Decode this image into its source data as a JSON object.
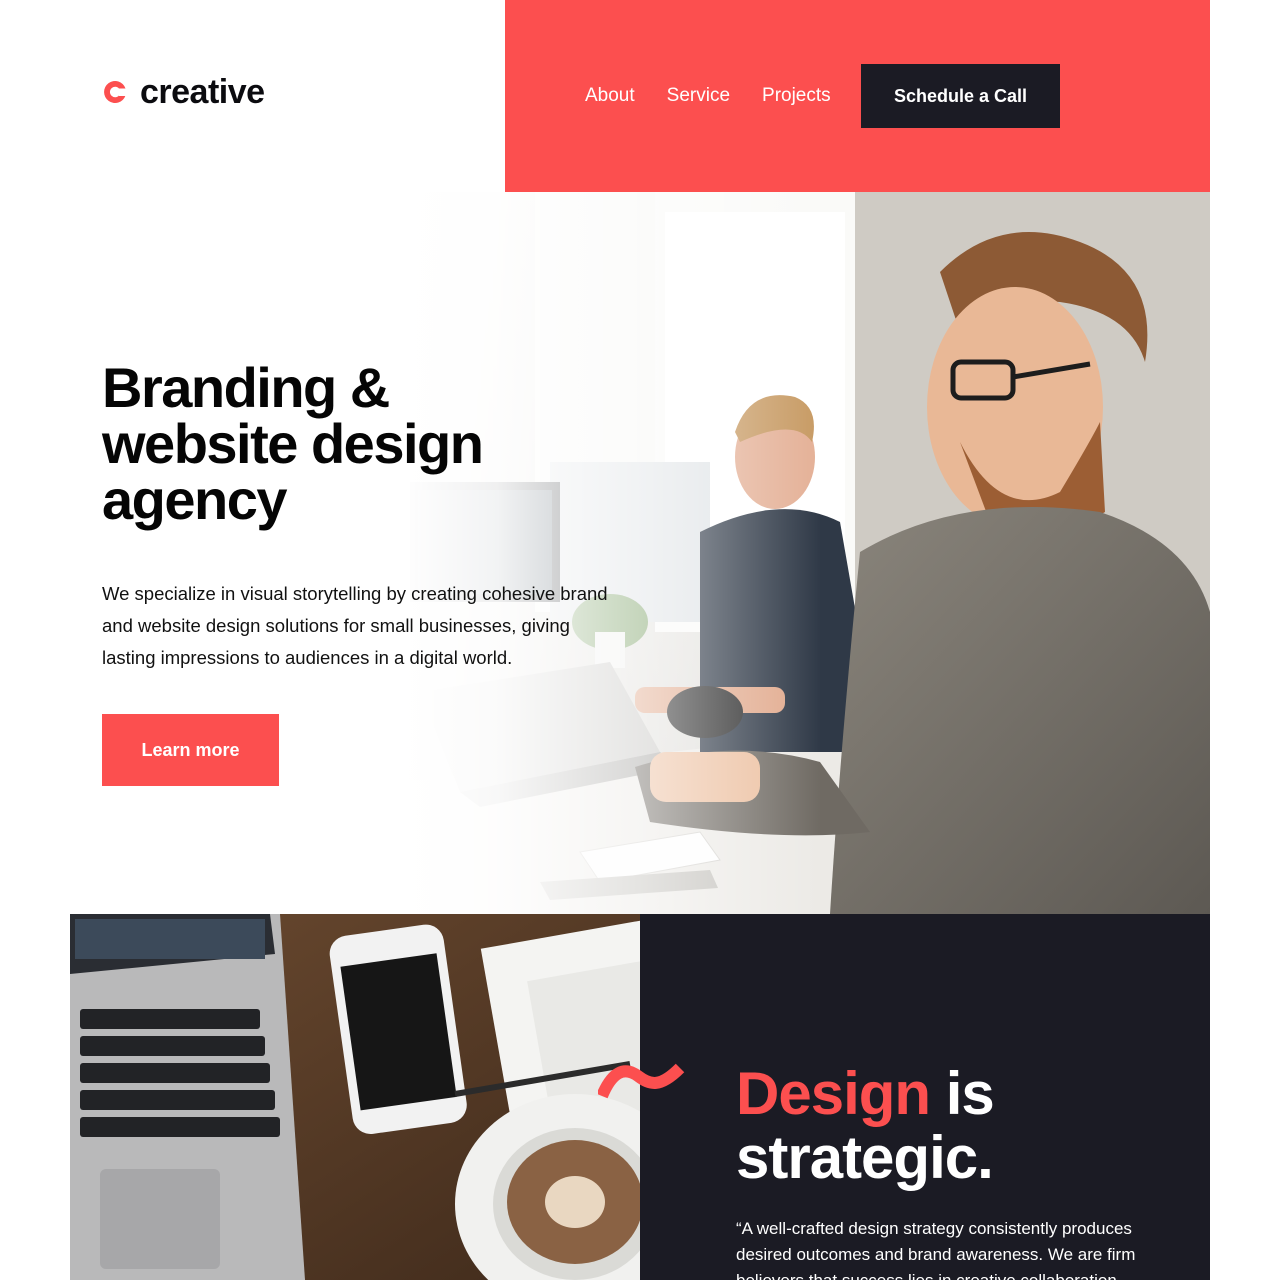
{
  "brand": {
    "name": "creative",
    "accent_color": "#fc4f4f",
    "dark_color": "#1b1b24"
  },
  "nav": {
    "items": [
      {
        "label": "About"
      },
      {
        "label": "Service"
      },
      {
        "label": "Projects"
      }
    ],
    "cta_label": "Schedule a Call"
  },
  "hero": {
    "title": "Branding & website design agency",
    "description": "We specialize in visual storytelling by creating cohesive brand and website design solutions for small businesses, giving lasting impressions to audiences in a digital world.",
    "button_label": "Learn more",
    "image": "two men working at computers in a bright office"
  },
  "feature": {
    "title_accent": "Design",
    "title_rest": " is strategic.",
    "quote": "“A well-crafted design strategy consistently produces desired outcomes and brand awareness. We are firm believers that success lies in creative collaboration with",
    "image": "top-down desk with laptop, phone, notebook and coffee cup",
    "icon": "squiggle-icon"
  }
}
